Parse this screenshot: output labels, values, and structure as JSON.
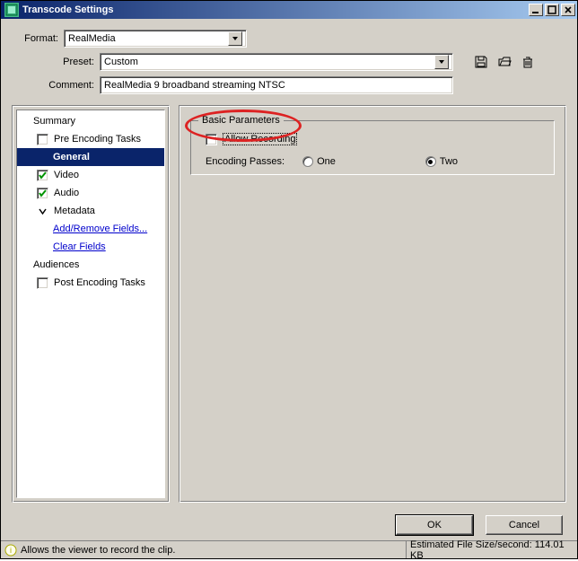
{
  "window": {
    "title": "Transcode Settings"
  },
  "form": {
    "format_label": "Format:",
    "format_value": "RealMedia",
    "preset_label": "Preset:",
    "preset_value": "Custom",
    "comment_label": "Comment:",
    "comment_value": "RealMedia 9 broadband streaming NTSC"
  },
  "sidebar": {
    "summary_label": "Summary",
    "pre_label": "Pre Encoding Tasks",
    "general_label": "General",
    "video_label": "Video",
    "audio_label": "Audio",
    "metadata_label": "Metadata",
    "add_remove_label": "Add/Remove Fields...",
    "clear_fields_label": "Clear Fields",
    "audiences_label": "Audiences",
    "post_label": "Post Encoding Tasks",
    "pre_checked": false,
    "video_checked": true,
    "audio_checked": true,
    "post_checked": false
  },
  "basic": {
    "legend": "Basic Parameters",
    "allow_recording_label": "Allow Recording",
    "allow_recording_checked": false,
    "encoding_passes_label": "Encoding Passes:",
    "one_label": "One",
    "two_label": "Two",
    "selected_pass": "two"
  },
  "buttons": {
    "ok": "OK",
    "cancel": "Cancel"
  },
  "status": {
    "hint": "Allows the viewer to record the clip.",
    "filesize_label": "Estimated File Size/second: 114.01 KB"
  }
}
